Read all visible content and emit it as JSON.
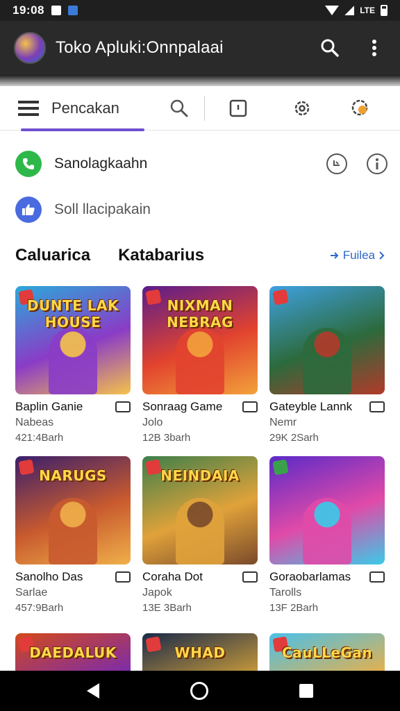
{
  "status_bar": {
    "time": "19:08",
    "network": "LTE"
  },
  "app_bar": {
    "title": "Toko Apluki:Onnpalaai"
  },
  "tabs": {
    "active_label": "Pencakan"
  },
  "rows": [
    {
      "label": "Sanolagkaahn",
      "icon": "phone-icon",
      "color": "#2fb84a"
    },
    {
      "label": "Soll llacipakain",
      "icon": "thumbs-up-icon",
      "color": "#4a6be0"
    }
  ],
  "section": {
    "title_left": "Caluarica",
    "title_right": "Katabarius",
    "more_label": "Fuilea"
  },
  "games": [
    {
      "title": "Baplin Ganie",
      "dev": "Nabeas",
      "size": "421:4Barh",
      "art": "DUNTE LAK HOUSE",
      "bg": [
        "#2aa9d9",
        "#8a3cc7",
        "#f5c24a"
      ],
      "badge": "red"
    },
    {
      "title": "Sonraag Game",
      "dev": "Jolo",
      "size": "12B 3barh",
      "art": "NIXMAN NEBRAG",
      "bg": [
        "#5a1c8c",
        "#e2432e",
        "#f2a23b"
      ],
      "badge": "red"
    },
    {
      "title": "Gateyble Lannk",
      "dev": "Nemr",
      "size": "29K 2Sarh",
      "art": "",
      "bg": [
        "#3fa0e0",
        "#2c6a3c",
        "#b23a2a"
      ],
      "badge": "red"
    },
    {
      "title": "Sanolho Das",
      "dev": "Sarlae",
      "size": "457:9Barh",
      "art": "NARUGS",
      "bg": [
        "#3a1f6c",
        "#c85a2e",
        "#f0b04a"
      ],
      "badge": "red"
    },
    {
      "title": "Coraha Dot",
      "dev": "Japok",
      "size": "13E 3Barh",
      "art": "NEINDAIA",
      "bg": [
        "#3d7f4a",
        "#e0a23a",
        "#7a4a2a"
      ],
      "badge": "red"
    },
    {
      "title": "Goraobarlamas",
      "dev": "Tarolls",
      "size": "13F 2Barh",
      "art": "",
      "bg": [
        "#5a2ac9",
        "#e04aa8",
        "#3acbe8"
      ],
      "badge": "green"
    },
    {
      "title": "",
      "dev": "",
      "size": "",
      "art": "DAEDALUK",
      "bg": [
        "#d24a1a",
        "#7a2ab0",
        "#f0a03a"
      ],
      "badge": "red"
    },
    {
      "title": "",
      "dev": "",
      "size": "",
      "art": "WHAD",
      "bg": [
        "#1a2a4a",
        "#c89a3a",
        "#3a5a8a"
      ],
      "badge": "red"
    },
    {
      "title": "",
      "dev": "",
      "size": "",
      "art": "CauLLeGan",
      "bg": [
        "#4ac0e8",
        "#e8b04a",
        "#3a8a3a"
      ],
      "badge": "red"
    }
  ]
}
